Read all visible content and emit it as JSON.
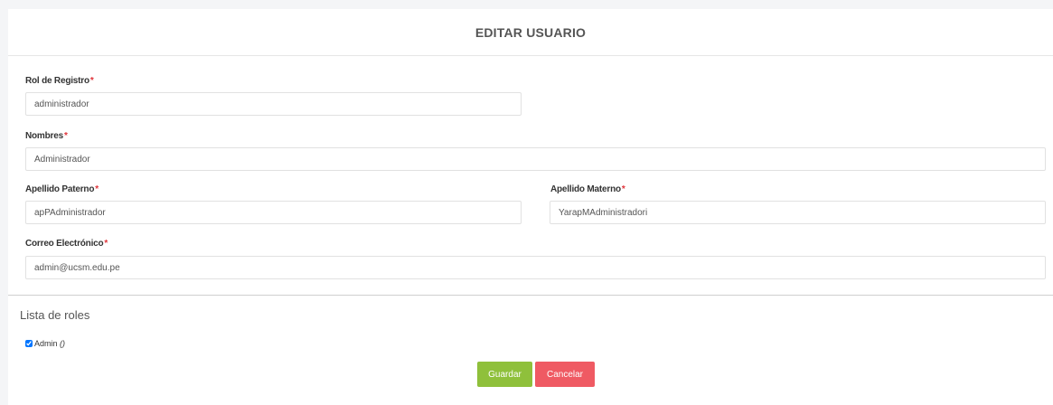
{
  "form": {
    "title": "EDITAR USUARIO",
    "required_mark": "*",
    "rol": {
      "label": "Rol de Registro",
      "value": "administrador"
    },
    "nombres": {
      "label": "Nombres",
      "value": "Administrador"
    },
    "apellido_paterno": {
      "label": "Apellido Paterno",
      "value": "apPAdministrador"
    },
    "apellido_materno": {
      "label": "Apellido Materno",
      "value": "YarapMAdministradori"
    },
    "correo": {
      "label": "Correo Electrónico",
      "value": "admin@ucsm.edu.pe"
    }
  },
  "roles": {
    "title": "Lista de roles",
    "items": [
      {
        "label": "Admin",
        "suffix": "()",
        "checked": true
      }
    ]
  },
  "buttons": {
    "save_label": "Guardar",
    "cancel_label": "Cancelar"
  },
  "colors": {
    "save": "#8fc03b",
    "cancel": "#ef5a63",
    "required": "#e0343a"
  }
}
